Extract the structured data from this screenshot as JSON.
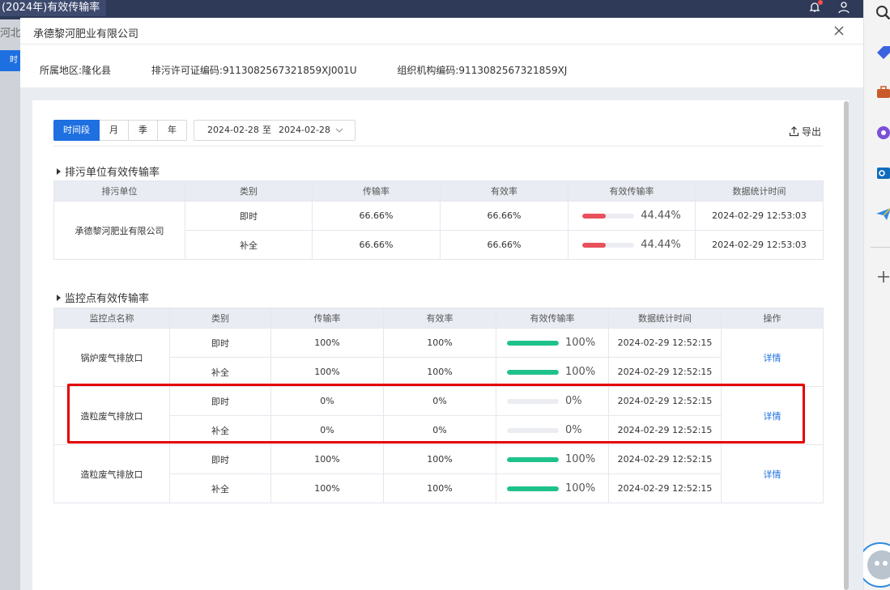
{
  "app": {
    "window_title": "(2024年)有效传输率",
    "bg_region_label": "河北",
    "bg_tab_label": "时"
  },
  "modal": {
    "title": "承德黎河肥业有限公司",
    "info": {
      "region_label": "所属地区:",
      "region_value": "隆化县",
      "permit_label": "排污许可证编码:",
      "permit_value": "9113082567321859XJ001U",
      "org_label": "组织机构编码:",
      "org_value": "9113082567321859XJ"
    }
  },
  "toolbar": {
    "tabs": [
      "时间段",
      "月",
      "季",
      "年"
    ],
    "active_tab": 0,
    "date_start": "2024-02-28",
    "date_sep": "至",
    "date_end": "2024-02-28",
    "export_label": "导出"
  },
  "unit_section": {
    "title": "排污单位有效传输率",
    "columns": [
      "排污单位",
      "类别",
      "传输率",
      "有效率",
      "有效传输率",
      "数据统计时间"
    ],
    "unit_name": "承德黎河肥业有限公司",
    "rows": [
      {
        "category": "即时",
        "transmission": "66.66%",
        "validity": "66.66%",
        "effective": "44.44%",
        "effective_value": 44.44,
        "time": "2024-02-29 12:53:03"
      },
      {
        "category": "补全",
        "transmission": "66.66%",
        "validity": "66.66%",
        "effective": "44.44%",
        "effective_value": 44.44,
        "time": "2024-02-29 12:53:03"
      }
    ]
  },
  "point_section": {
    "title": "监控点有效传输率",
    "columns": [
      "监控点名称",
      "类别",
      "传输率",
      "有效率",
      "有效传输率",
      "数据统计时间",
      "操作"
    ],
    "action_label": "详情",
    "groups": [
      {
        "name": "锅炉废气排放口",
        "rows": [
          {
            "category": "即时",
            "transmission": "100%",
            "validity": "100%",
            "effective": "100%",
            "effective_value": 100,
            "time": "2024-02-29 12:52:15"
          },
          {
            "category": "补全",
            "transmission": "100%",
            "validity": "100%",
            "effective": "100%",
            "effective_value": 100,
            "time": "2024-02-29 12:52:15"
          }
        ]
      },
      {
        "name": "造粒废气排放口",
        "rows": [
          {
            "category": "即时",
            "transmission": "0%",
            "validity": "0%",
            "effective": "0%",
            "effective_value": 0,
            "time": "2024-02-29 12:52:15"
          },
          {
            "category": "补全",
            "transmission": "0%",
            "validity": "0%",
            "effective": "0%",
            "effective_value": 0,
            "time": "2024-02-29 12:52:15"
          }
        ]
      },
      {
        "name": "造粒废气排放口",
        "rows": [
          {
            "category": "即时",
            "transmission": "100%",
            "validity": "100%",
            "effective": "100%",
            "effective_value": 100,
            "time": "2024-02-29 12:52:15"
          },
          {
            "category": "补全",
            "transmission": "100%",
            "validity": "100%",
            "effective": "100%",
            "effective_value": 100,
            "time": "2024-02-29 12:52:15"
          }
        ]
      }
    ]
  },
  "colors": {
    "accent": "#1e6fe0",
    "bar_low": "#e8505b",
    "bar_high": "#1fc28b",
    "highlight": "#e60000"
  },
  "icons": [
    "close-icon",
    "export-icon",
    "chevron-down-icon",
    "bell-icon",
    "user-icon",
    "search-icon",
    "plus-icon"
  ]
}
